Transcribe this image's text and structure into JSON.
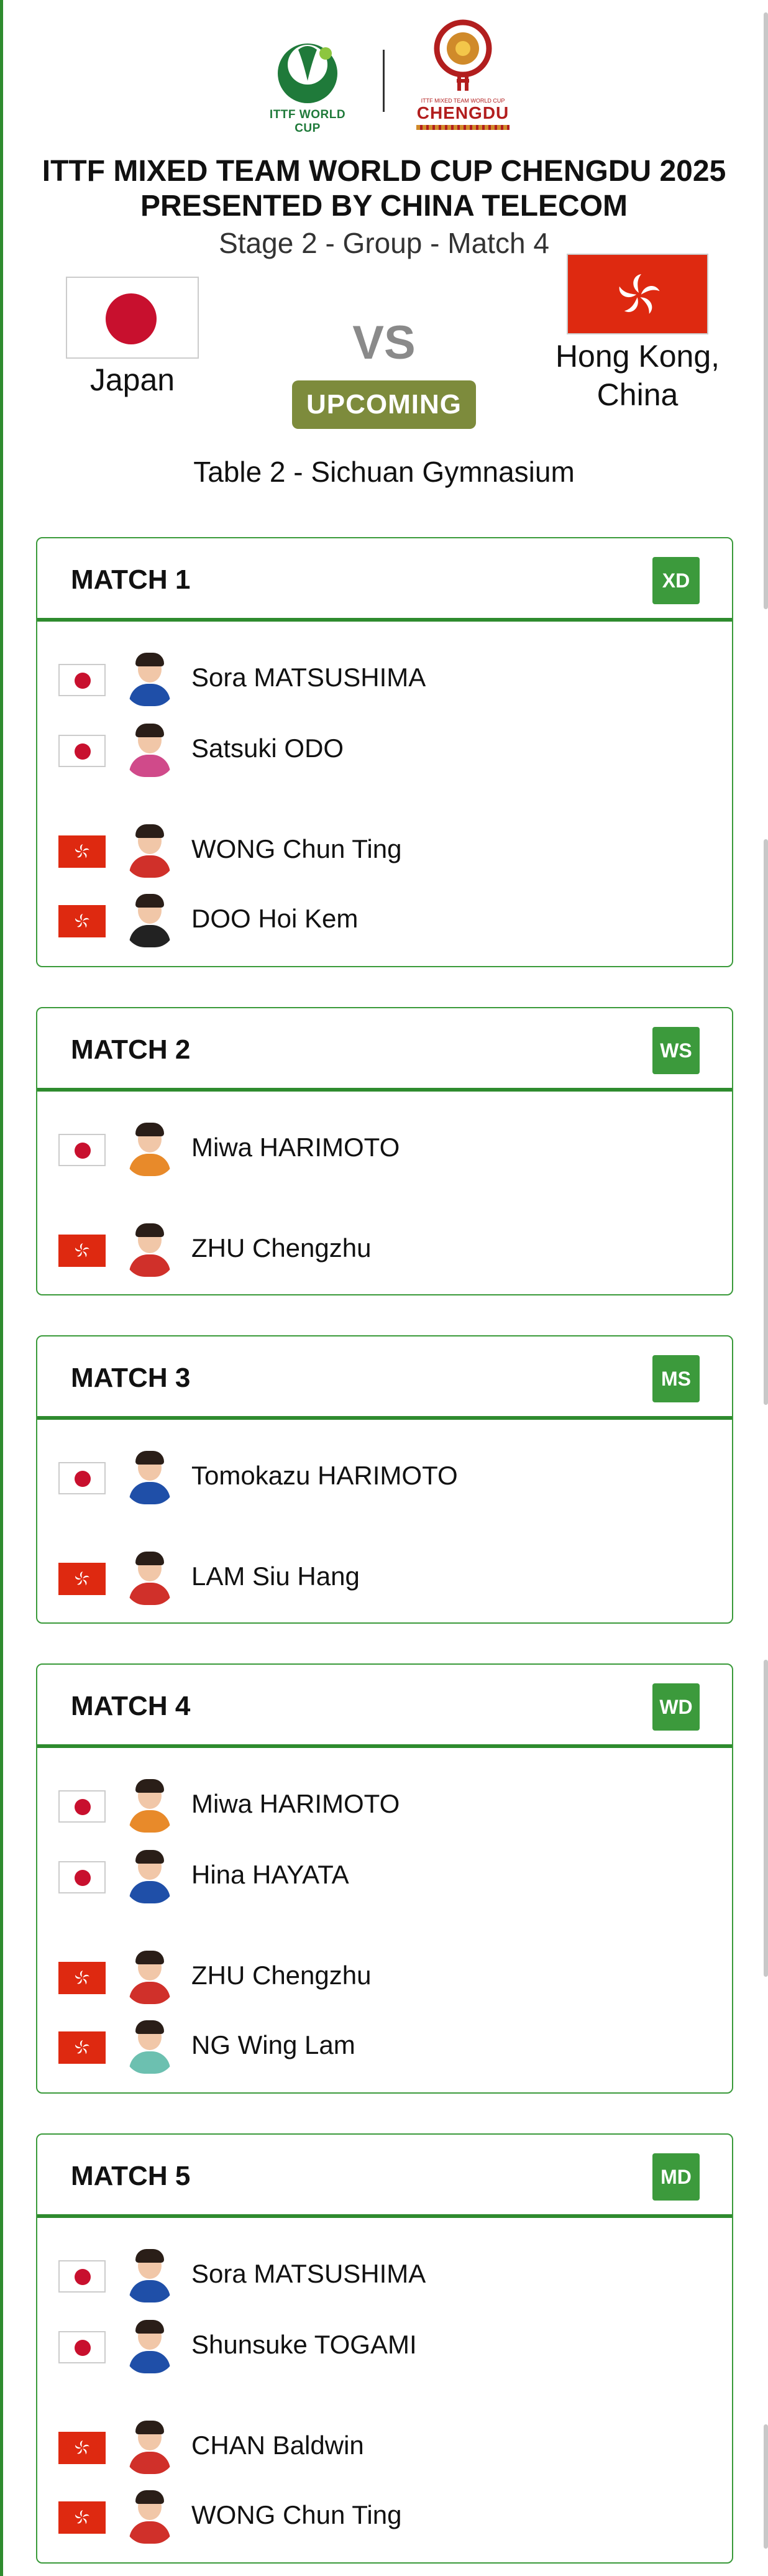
{
  "logos": {
    "ittf_label": "ITTF WORLD CUP",
    "chengdu_small": "ITTF MIXED TEAM WORLD CUP",
    "chengdu_label": "CHENGDU"
  },
  "event": {
    "title_line1": "ITTF MIXED TEAM WORLD CUP CHENGDU 2025",
    "title_line2": "PRESENTED BY CHINA TELECOM",
    "stage": "Stage 2 - Group - Match 4"
  },
  "teams": {
    "home": {
      "name": "Japan"
    },
    "away": {
      "name_line1": "Hong Kong,",
      "name_line2": "China"
    },
    "vs": "VS",
    "status": "UPCOMING"
  },
  "venue": "Table 2 - Sichuan Gymnasium",
  "matches": [
    {
      "title": "MATCH 1",
      "badge": "XD",
      "players": [
        "Sora MATSUSHIMA",
        "Satsuki ODO",
        "WONG Chun Ting",
        "DOO Hoi Kem"
      ]
    },
    {
      "title": "MATCH 2",
      "badge": "WS",
      "players": [
        "Miwa HARIMOTO",
        "ZHU Chengzhu"
      ]
    },
    {
      "title": "MATCH 3",
      "badge": "MS",
      "players": [
        "Tomokazu HARIMOTO",
        "LAM Siu Hang"
      ]
    },
    {
      "title": "MATCH 4",
      "badge": "WD",
      "players": [
        "Miwa HARIMOTO",
        "Hina HAYATA",
        "ZHU Chengzhu",
        "NG Wing Lam"
      ]
    },
    {
      "title": "MATCH 5",
      "badge": "MD",
      "players": [
        "Sora MATSUSHIMA",
        "Shunsuke TOGAMI",
        "CHAN Baldwin",
        "WONG Chun Ting"
      ]
    }
  ],
  "colors": {
    "accent_green": "#2e8b2e",
    "status_olive": "#7d8b3c",
    "japan_red": "#c8102e",
    "hk_red": "#de2910"
  },
  "icons": {
    "japan_flag": "japan-flag-icon",
    "hk_flag": "hong-kong-flag-icon",
    "avatar": "player-avatar-icon"
  }
}
